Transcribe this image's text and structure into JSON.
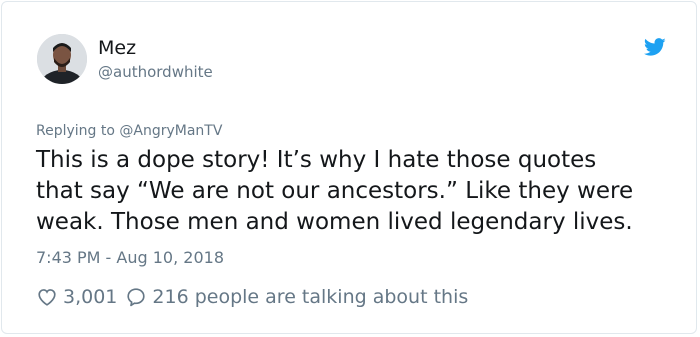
{
  "author": {
    "name": "Mez",
    "handle": "@authordwhite"
  },
  "replying": {
    "prefix": "Replying to",
    "mention": "@AngryManTV"
  },
  "tweet": {
    "lines": [
      "This is a dope story! It’s why I hate those quotes",
      "that say “We are not our ancestors.” Like they were",
      "weak. Those men and women lived legendary lives."
    ]
  },
  "timestamp": "7:43 PM - Aug 10, 2018",
  "stats": {
    "likes": "3,001",
    "replies": "216 people are talking about this"
  },
  "icons": {
    "brand": "twitter-bird-icon",
    "like": "heart-icon",
    "reply": "speech-bubble-icon"
  },
  "colors": {
    "brand": "#1da1f2",
    "text": "#14171a",
    "secondary": "#657786"
  }
}
